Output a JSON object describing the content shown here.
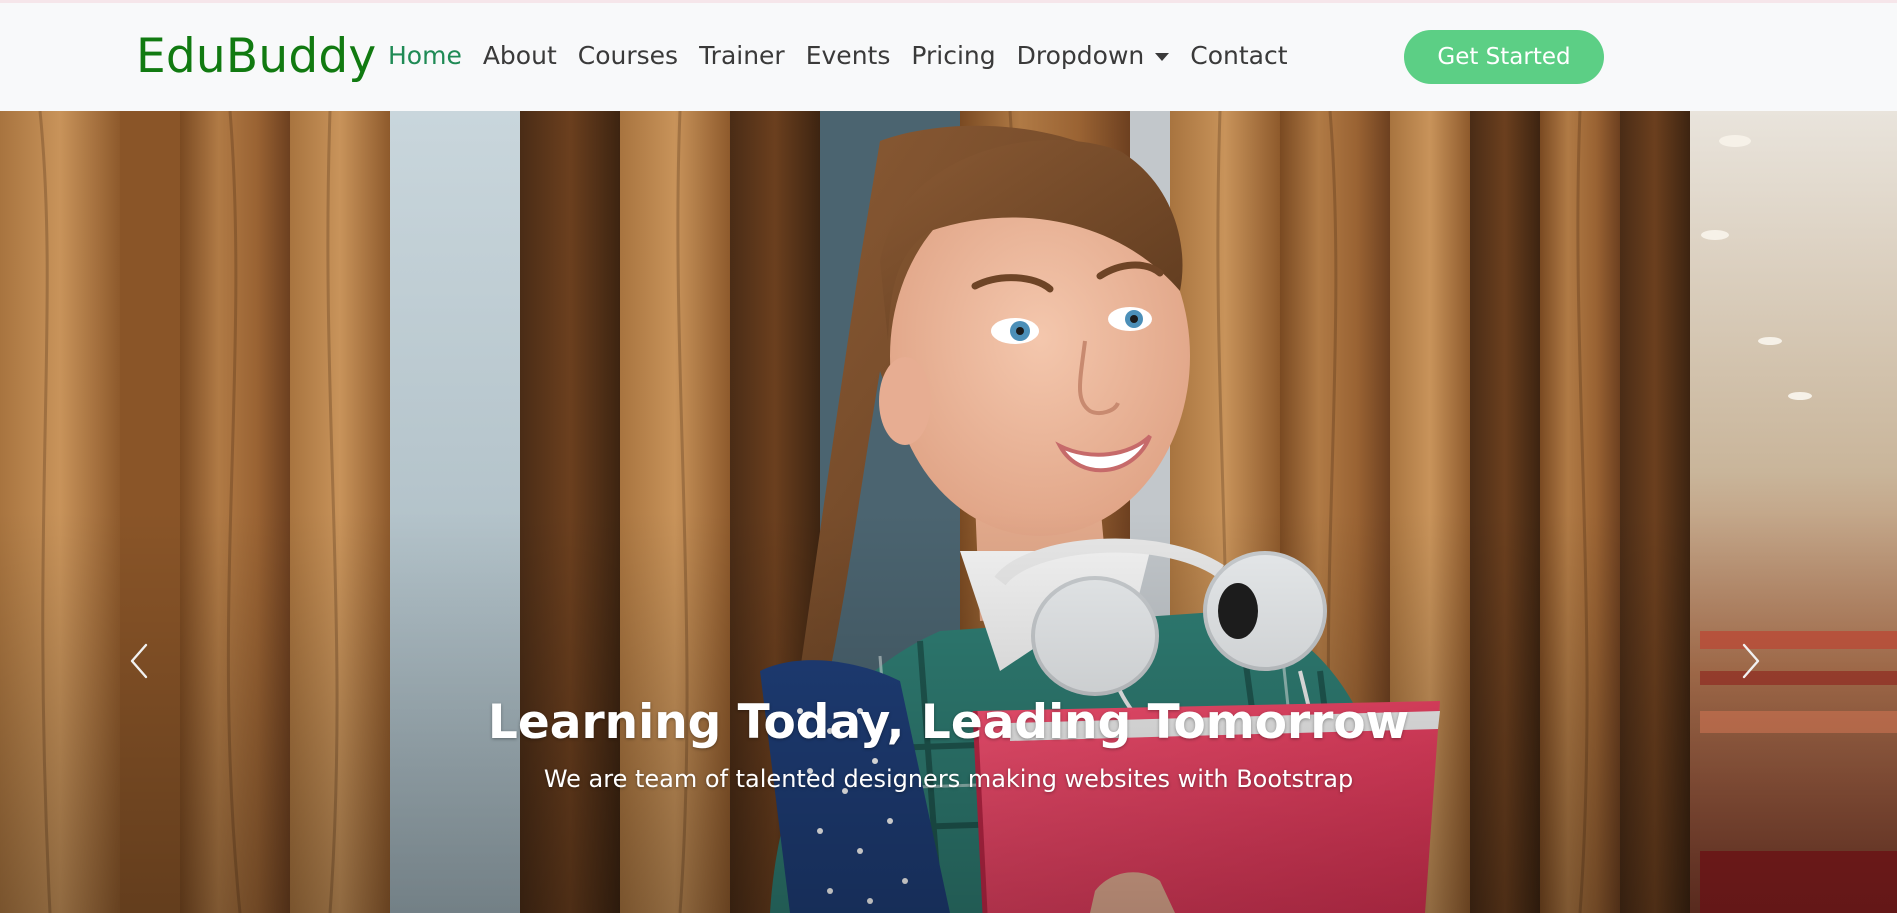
{
  "brand": "EduBuddy",
  "nav": {
    "home": "Home",
    "about": "About",
    "courses": "Courses",
    "trainer": "Trainer",
    "events": "Events",
    "pricing": "Pricing",
    "dropdown": "Dropdown",
    "contact": "Contact"
  },
  "cta": "Get Started",
  "hero": {
    "headline": "Learning Today, Leading Tomorrow",
    "subline": "We are team of talented designers making websites with Bootstrap",
    "prev_icon": "chevron-left-icon",
    "next_icon": "chevron-right-icon"
  },
  "colors": {
    "brand": "#117a11",
    "active_link": "#1f8a55",
    "cta_bg": "#5ccf85",
    "navbar_bg": "#f8f9fa"
  }
}
